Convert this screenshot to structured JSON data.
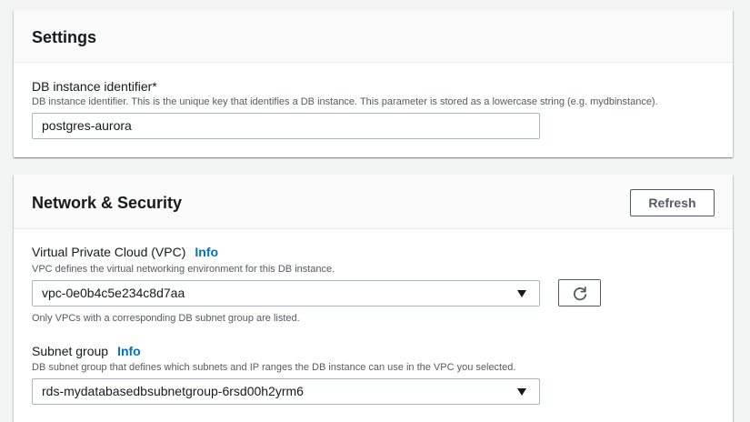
{
  "settings": {
    "title": "Settings",
    "db_identifier": {
      "label": "DB instance identifier*",
      "description": "DB instance identifier. This is the unique key that identifies a DB instance. This parameter is stored as a lowercase string (e.g. mydbinstance).",
      "value": "postgres-aurora"
    }
  },
  "network": {
    "title": "Network & Security",
    "refresh_label": "Refresh",
    "vpc": {
      "label": "Virtual Private Cloud (VPC)",
      "info_label": "Info",
      "description": "VPC defines the virtual networking environment for this DB instance.",
      "selected": "vpc-0e0b4c5e234c8d7aa",
      "hint": "Only VPCs with a corresponding DB subnet group are listed."
    },
    "subnet_group": {
      "label": "Subnet group",
      "info_label": "Info",
      "description": "DB subnet group that defines which subnets and IP ranges the DB instance can use in the VPC you selected.",
      "selected": "rds-mydatabasedbsubnetgroup-6rsd00h2yrm6"
    }
  },
  "colors": {
    "background": "#f2f3f3",
    "link": "#0073bb",
    "text": "#16191f",
    "secondary_text": "#545b64"
  },
  "icons": {
    "refresh": "refresh-icon",
    "dropdown": "caret-down-icon"
  }
}
